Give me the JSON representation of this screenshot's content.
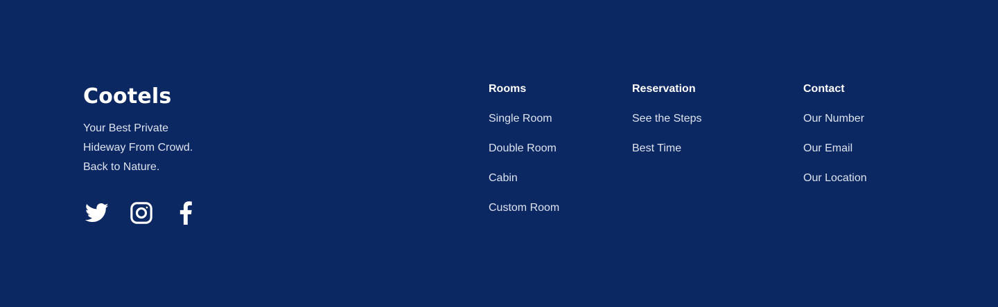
{
  "colors": {
    "background": "#0C2862",
    "text": "#FFFFFF",
    "link_text": "#DDE3F0"
  },
  "brand": {
    "name": "Cootels",
    "tagline_lines": [
      "Your Best Private",
      "Hideway From Crowd.",
      "Back to Nature."
    ]
  },
  "socials": [
    {
      "icon": "twitter-icon"
    },
    {
      "icon": "instagram-icon"
    },
    {
      "icon": "facebook-icon"
    }
  ],
  "columns": [
    {
      "title": "Rooms",
      "links": [
        "Single Room",
        "Double Room",
        "Cabin",
        "Custom Room"
      ]
    },
    {
      "title": "Reservation",
      "links": [
        "See the Steps",
        "Best Time"
      ]
    },
    {
      "title": "Contact",
      "links": [
        "Our Number",
        "Our Email",
        "Our Location"
      ]
    }
  ]
}
